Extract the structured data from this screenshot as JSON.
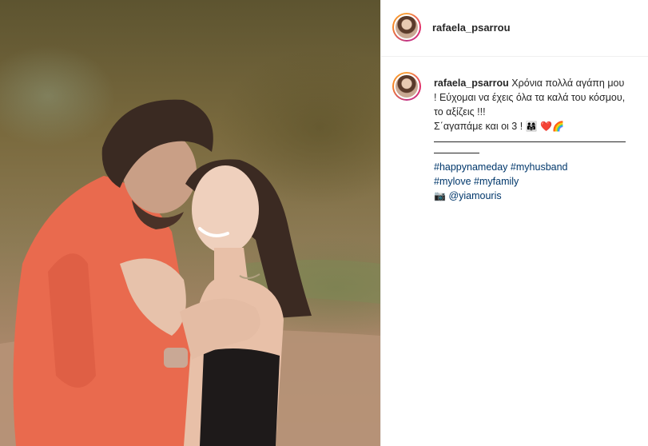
{
  "post": {
    "username": "rafaela_psarrou",
    "caption_line1": "Χρόνια πολλά αγάπη μου ! Εύχομαι να έχεις όλα τα καλά του κόσμου, το αξίζεις !!!",
    "caption_line2": "Σ΄αγαπάμε και οι 3 !",
    "caption_emojis": [
      "👨‍👩‍👧",
      "❤️",
      "🌈"
    ],
    "hashtags": [
      "#happynameday",
      "#myhusband",
      "#mylove",
      "#myfamily"
    ],
    "credit_icon": "camera-icon",
    "credit_mention": "@yiamouris"
  },
  "photo": {
    "subject": "couple-embracing-outdoors"
  }
}
